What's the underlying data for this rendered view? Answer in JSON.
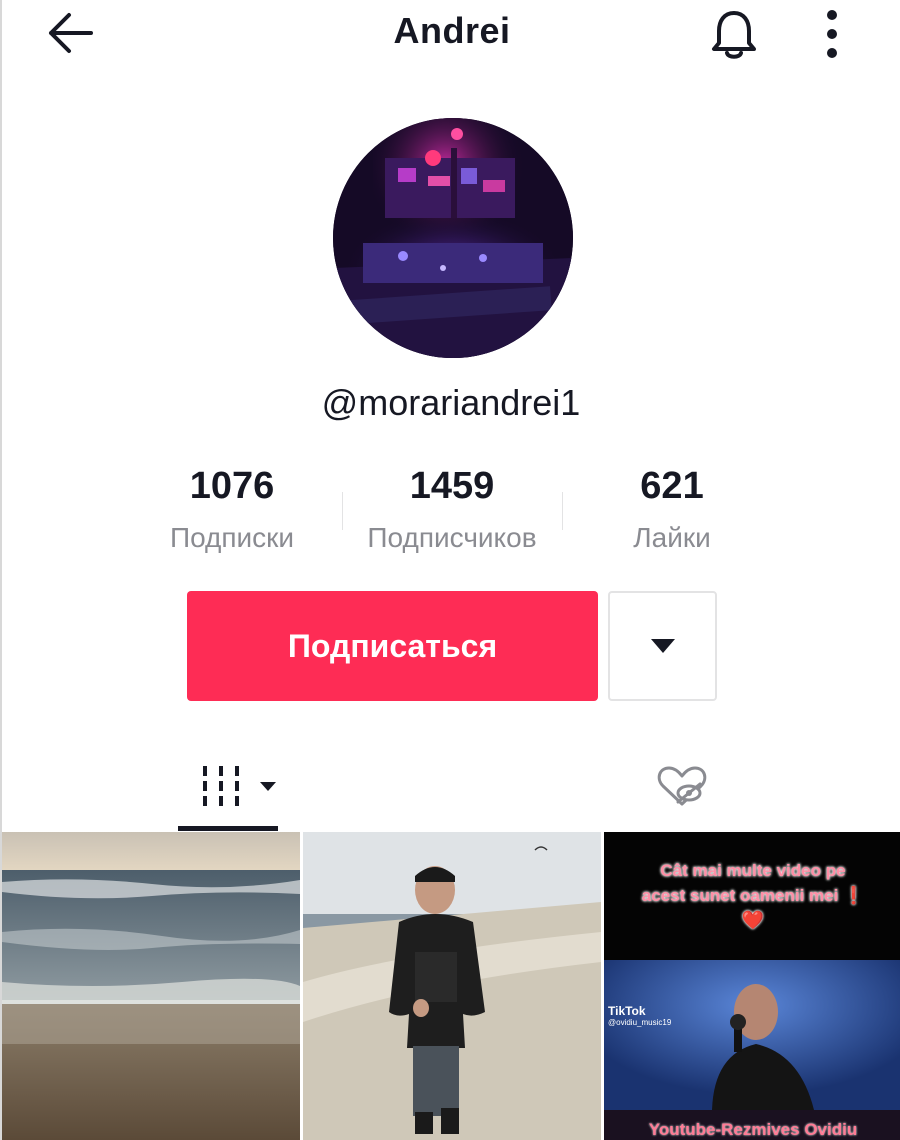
{
  "header": {
    "title": "Andrei",
    "back_icon": "arrow-left-icon",
    "notification_icon": "bell-icon",
    "more_icon": "more-vertical-icon"
  },
  "profile": {
    "username": "@morariandrei1",
    "avatar_icon": "avatar-disco-image"
  },
  "stats": [
    {
      "value": "1076",
      "label": "Подписки"
    },
    {
      "value": "1459",
      "label": "Подписчиков"
    },
    {
      "value": "621",
      "label": "Лайки"
    }
  ],
  "actions": {
    "follow_label": "Подписаться",
    "follow_color": "#fe2c55",
    "dropdown_icon": "caret-down-icon"
  },
  "tabs": [
    {
      "name": "videos",
      "icon": "grid-icon",
      "active": true
    },
    {
      "name": "liked",
      "icon": "heart-hidden-icon",
      "active": false
    }
  ],
  "videos": [
    {
      "scene": "sea-waves"
    },
    {
      "scene": "man-on-beach"
    },
    {
      "scene": "singer-promo",
      "caption_line1": "Cât mai multe video pe",
      "caption_line2": "acest sunet oamenii mei ❗",
      "caption_heart": "❤️",
      "watermark": "TikTok",
      "watermark_handle": "@ovidiu_music19",
      "bottom_caption": "Youtube-Rezmives Ovidiu"
    }
  ]
}
